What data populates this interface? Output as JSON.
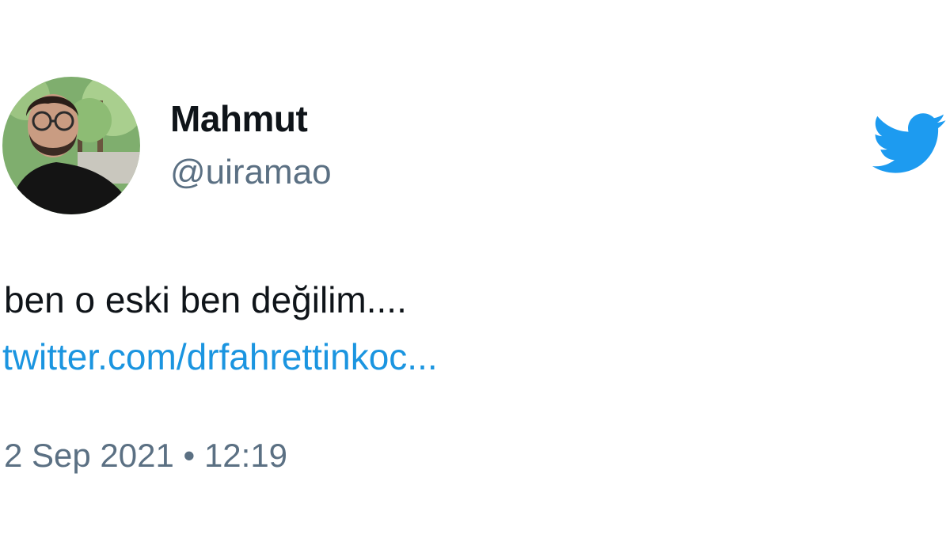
{
  "author": {
    "display_name": "Mahmut",
    "handle": "@uiramao",
    "avatar_icon": "profile-photo"
  },
  "tweet": {
    "text": "ben o eski ben değilim....",
    "link_text": "twitter.com/drfahrettinkoc...",
    "date": "2 Sep 2021",
    "separator": "•",
    "time": "12:19"
  },
  "brand": {
    "logo_icon": "twitter-bird-icon",
    "accent_color": "#1d9bf0",
    "link_color": "#1b95e0",
    "muted_color": "#5b7083",
    "text_color": "#0f1419"
  }
}
